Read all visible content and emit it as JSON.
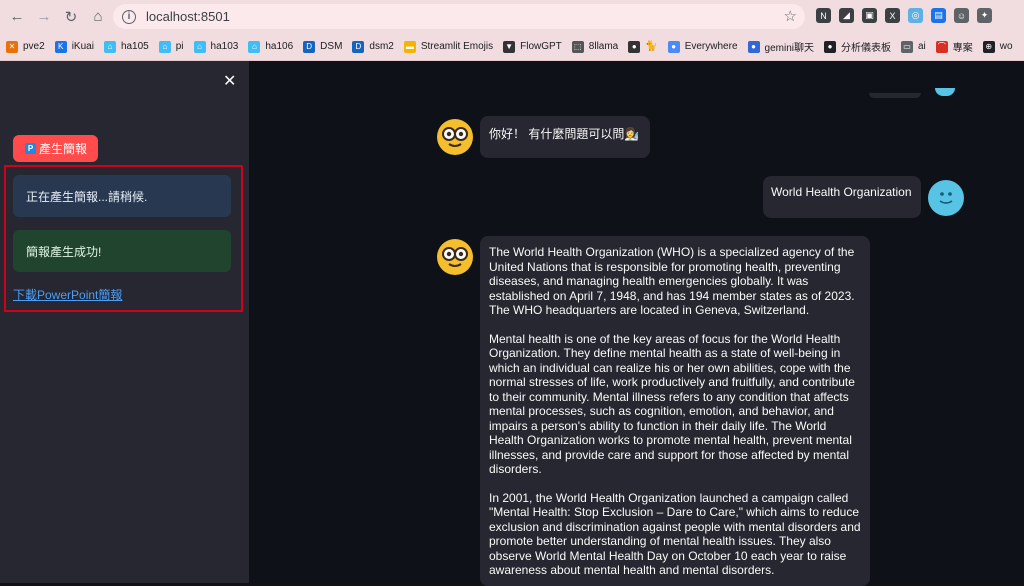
{
  "browser": {
    "url": "localhost:8501",
    "bookmarks": [
      {
        "label": "pve2",
        "color": "#e8710a",
        "glyph": "✕"
      },
      {
        "label": "iKuai",
        "color": "#1a73e8",
        "glyph": "K"
      },
      {
        "label": "ha105",
        "color": "#41bdf5",
        "glyph": "⌂"
      },
      {
        "label": "pi",
        "color": "#41bdf5",
        "glyph": "⌂"
      },
      {
        "label": "ha103",
        "color": "#41bdf5",
        "glyph": "⌂"
      },
      {
        "label": "ha106",
        "color": "#41bdf5",
        "glyph": "⌂"
      },
      {
        "label": "DSM",
        "color": "#1565c0",
        "glyph": "D"
      },
      {
        "label": "dsm2",
        "color": "#1565c0",
        "glyph": "D"
      },
      {
        "label": "Streamlit Emojis",
        "color": "#f4b400",
        "glyph": "▬"
      },
      {
        "label": "FlowGPT",
        "color": "#333333",
        "glyph": "▼"
      },
      {
        "label": "8llama",
        "color": "#555555",
        "glyph": "⬚"
      },
      {
        "label": "🐈",
        "color": "#333333",
        "glyph": "●"
      },
      {
        "label": "Everywhere",
        "color": "#4c8bf5",
        "glyph": "●"
      },
      {
        "label": "gemini聊天",
        "color": "#3367d6",
        "glyph": "●"
      },
      {
        "label": "分析儀表板",
        "color": "#202124",
        "glyph": "●"
      },
      {
        "label": "ai",
        "color": "#5f6368",
        "glyph": "▭"
      },
      {
        "label": "專案",
        "color": "#d93025",
        "glyph": "⌒"
      },
      {
        "label": "wo",
        "color": "#202124",
        "glyph": "⊕"
      }
    ]
  },
  "sidebar": {
    "generate_button": "產生簡報",
    "status_info": "正在產生簡報...請稍候.",
    "status_success": "簡報產生成功!",
    "download_link": "下載PowerPoint簡報"
  },
  "chat": {
    "greeting": "你好！ 有什麼問題可以問👩‍🔬",
    "user_message": "World Health Organization",
    "response_paragraphs": [
      "The World Health Organization (WHO) is a specialized agency of the United Nations that is responsible for promoting health, preventing diseases, and managing health emergencies globally. It was established on April 7, 1948, and has 194 member states as of 2023. The WHO headquarters are located in Geneva, Switzerland.",
      "Mental health is one of the key areas of focus for the World Health Organization. They define mental health as a state of well-being in which an individual can realize his or her own abilities, cope with the normal stresses of life, work productively and fruitfully, and contribute to their community. Mental illness refers to any condition that affects mental processes, such as cognition, emotion, and behavior, and impairs a person's ability to function in their daily life. The World Health Organization works to promote mental health, prevent mental illnesses, and provide care and support for those affected by mental disorders.",
      "In 2001, the World Health Organization launched a campaign called \"Mental Health: Stop Exclusion – Dare to Care,\" which aims to reduce exclusion and discrimination against people with mental disorders and promote better understanding of mental health issues. They also observe World Mental Health Day on October 10 each year to raise awareness about mental health and mental disorders."
    ]
  }
}
